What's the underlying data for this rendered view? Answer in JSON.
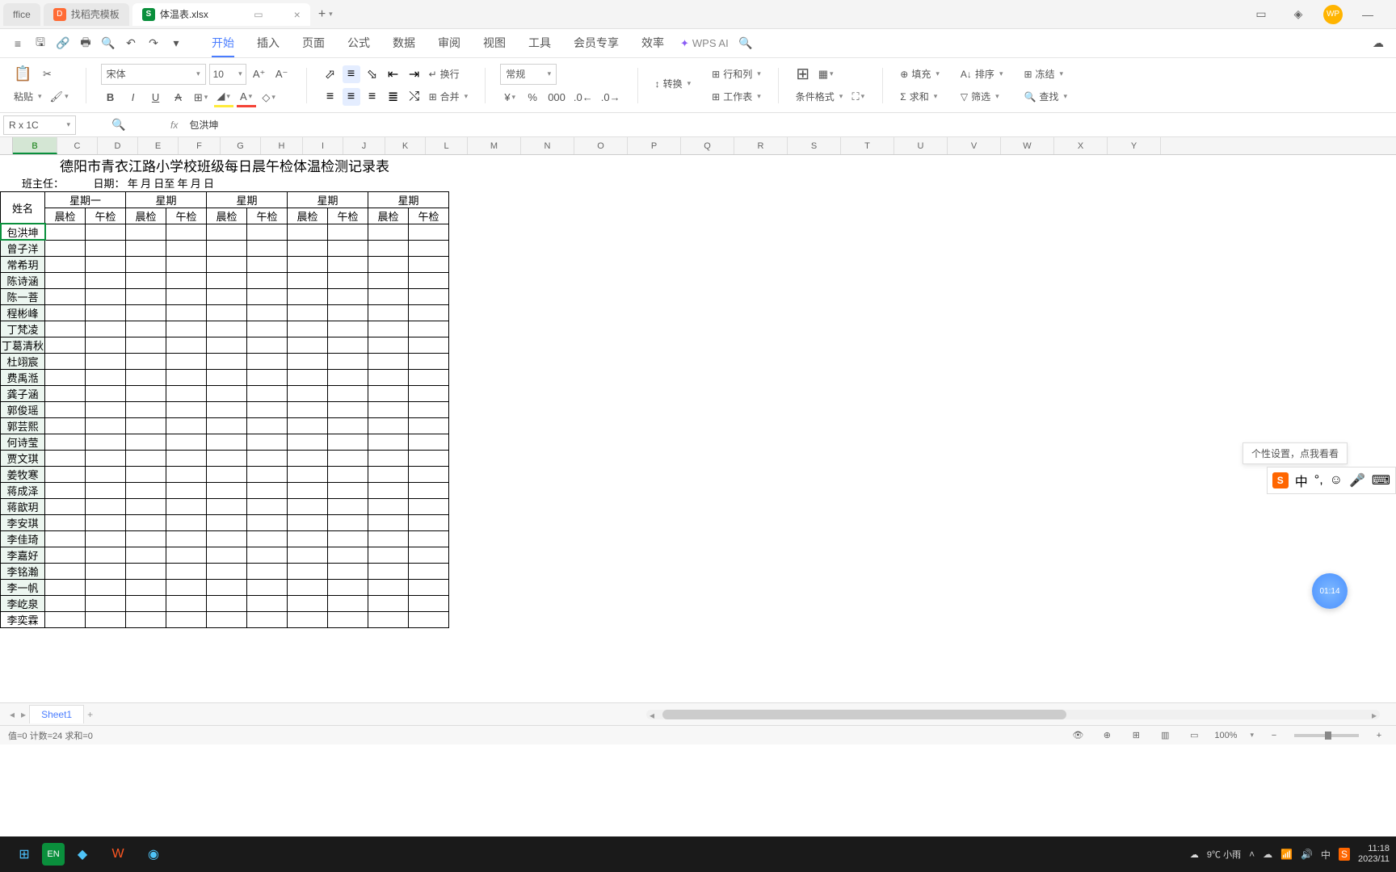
{
  "tabs": {
    "t0": "ffice",
    "t1": "找稻壳模板",
    "t2": "体温表.xlsx",
    "add": "+"
  },
  "window": {
    "avatar": "WP",
    "minimize": "—"
  },
  "ribbonTabs": {
    "start": "开始",
    "insert": "插入",
    "page": "页面",
    "formula": "公式",
    "data": "数据",
    "review": "审阅",
    "view": "视图",
    "tools": "工具",
    "member": "会员专享",
    "efficiency": "效率",
    "wpsai": "WPS AI"
  },
  "ribbon": {
    "paste": "粘贴",
    "font": "宋体",
    "fontsize": "10",
    "numfmt": "常规",
    "wrap": "换行",
    "convert": "转换",
    "rowcol": "行和列",
    "merge": "合并",
    "worksheet": "工作表",
    "condfmt": "条件格式",
    "fill": "填充",
    "sort": "排序",
    "freeze": "冻结",
    "sum": "求和",
    "filter": "筛选",
    "find": "查找"
  },
  "formulabar": {
    "namebox": "R x 1C",
    "fx": "fx",
    "value": "包洪坤"
  },
  "columns": [
    "B",
    "C",
    "D",
    "E",
    "F",
    "G",
    "H",
    "I",
    "J",
    "K",
    "L",
    "M",
    "N",
    "O",
    "P",
    "Q",
    "R",
    "S",
    "T",
    "U",
    "V",
    "W",
    "X",
    "Y"
  ],
  "sheet": {
    "title": "德阳市青衣江路小学校班级每日晨午检体温检测记录表",
    "subL": "班主任：",
    "subR": "日期：        年    月    日至        年    月    日",
    "nameHdr": "姓名",
    "weekdays": [
      "星期一",
      "星期",
      "星期",
      "星期",
      "星期"
    ],
    "morning": "晨检",
    "afternoon": "午检",
    "names": [
      "包洪坤",
      "曾子洋",
      "常希玥",
      "陈诗涵",
      "陈一菩",
      "程彬峰",
      "丁梵凌",
      "丁葛清秋",
      "杜翊宸",
      "费禹湉",
      "龚子涵",
      "郭俊瑶",
      "郭芸熙",
      "何诗莹",
      "贾文琪",
      "姜牧寒",
      "蒋成泽",
      "蒋歆玥",
      "李安琪",
      "李佳琦",
      "李嘉好",
      "李铭瀚",
      "李一帆",
      "李屹泉",
      "李奕霖"
    ]
  },
  "sheettab": {
    "name": "Sheet1",
    "add": "+"
  },
  "statusbar": {
    "stats": "值=0  计数=24  求和=0",
    "zoom": "100%"
  },
  "float": {
    "tip": "个性设置，点我看看",
    "sogou_cn": "中",
    "timer": "01:14"
  },
  "taskbar": {
    "weather": "9℃ 小雨",
    "ime": "中",
    "time": "11:18",
    "date": "2023/11"
  }
}
